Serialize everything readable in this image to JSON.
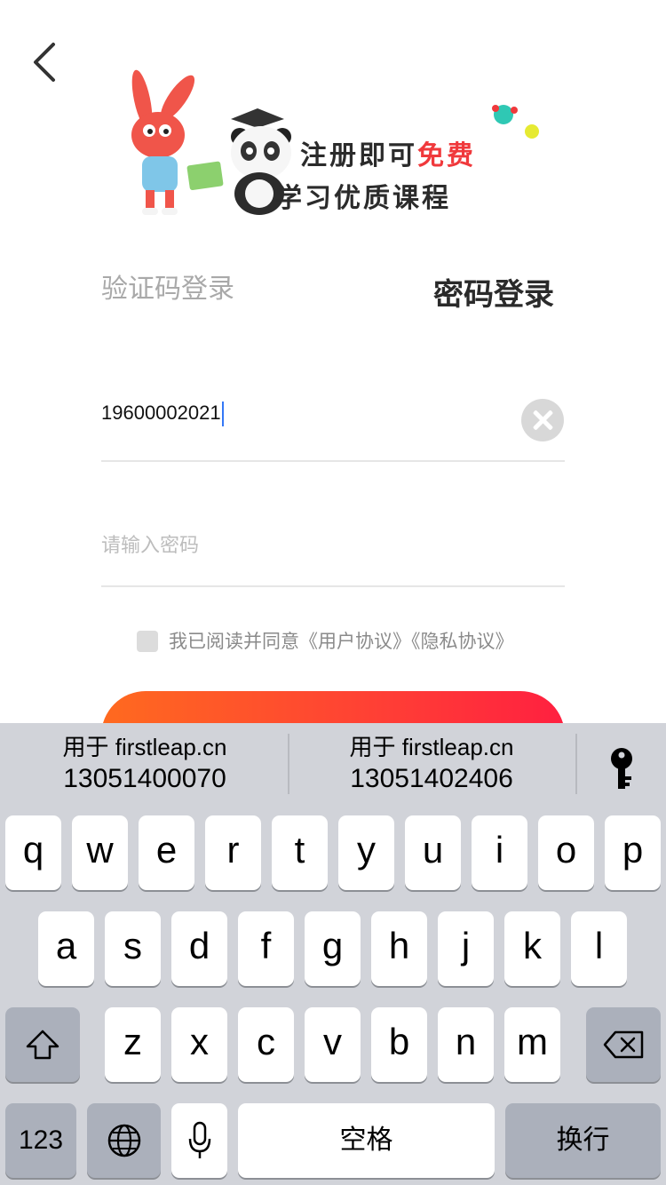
{
  "banner": {
    "line1_a": "注册即可",
    "line1_b": "免费",
    "line2": "学习优质课程"
  },
  "tabs": {
    "sms": "验证码登录",
    "password": "密码登录"
  },
  "form": {
    "phone_value": "19600002021",
    "password_placeholder": "请输入密码",
    "agree_text": "我已阅读并同意《用户协议》《隐私协议》"
  },
  "keyboard": {
    "suggestions": [
      {
        "title": "用于 firstleap.cn",
        "value": "13051400070"
      },
      {
        "title": "用于 firstleap.cn",
        "value": "13051402406"
      }
    ],
    "row1": [
      "q",
      "w",
      "e",
      "r",
      "t",
      "y",
      "u",
      "i",
      "o",
      "p"
    ],
    "row2": [
      "a",
      "s",
      "d",
      "f",
      "g",
      "h",
      "j",
      "k",
      "l"
    ],
    "row3": [
      "z",
      "x",
      "c",
      "v",
      "b",
      "n",
      "m"
    ],
    "num_label": "123",
    "space_label": "空格",
    "return_label": "换行"
  }
}
